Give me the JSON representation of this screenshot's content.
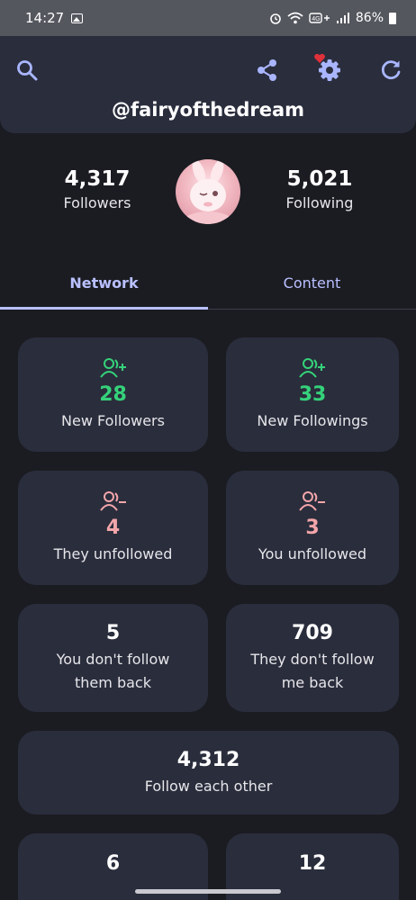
{
  "status_bar": {
    "time": "14:27",
    "battery": "86%",
    "icons": [
      "gallery-icon",
      "alarm-icon",
      "wifi-icon",
      "volte-icon",
      "signal-icon",
      "battery-icon"
    ]
  },
  "header": {
    "username": "@fairyofthedream",
    "icons": [
      "search-icon",
      "share-icon",
      "settings-icon",
      "refresh-icon"
    ],
    "accent": "#a9b6ff",
    "badge_color": "#e0313b"
  },
  "profile": {
    "followers_count": "4,317",
    "followers_label": "Followers",
    "following_count": "5,021",
    "following_label": "Following"
  },
  "tabs": [
    {
      "label": "Network",
      "selected": true
    },
    {
      "label": "Content",
      "selected": false
    }
  ],
  "cards": {
    "new_followers": {
      "count": "28",
      "label": "New Followers",
      "icon": "user-plus-icon"
    },
    "new_followings": {
      "count": "33",
      "label": "New Followings",
      "icon": "user-plus-icon"
    },
    "they_unfollowed": {
      "count": "4",
      "label": "They unfollowed",
      "icon": "user-minus-icon"
    },
    "you_unfollowed": {
      "count": "3",
      "label": "You unfollowed",
      "icon": "user-minus-icon"
    },
    "dont_follow_back": {
      "count": "5",
      "label_line1": "You don't follow",
      "label_line2": "them back"
    },
    "they_dont_follow": {
      "count": "709",
      "label_line1": "They don't follow",
      "label_line2": "me back"
    },
    "mutual": {
      "count": "4,312",
      "label": "Follow each other"
    },
    "partial_left": {
      "count": "6"
    },
    "partial_right": {
      "count": "12"
    }
  },
  "colors": {
    "background": "#1b1c22",
    "card": "#2a2d3c",
    "positive": "#35d27a",
    "negative": "#f3a6aa",
    "tab_accent": "#b9c0ff"
  }
}
